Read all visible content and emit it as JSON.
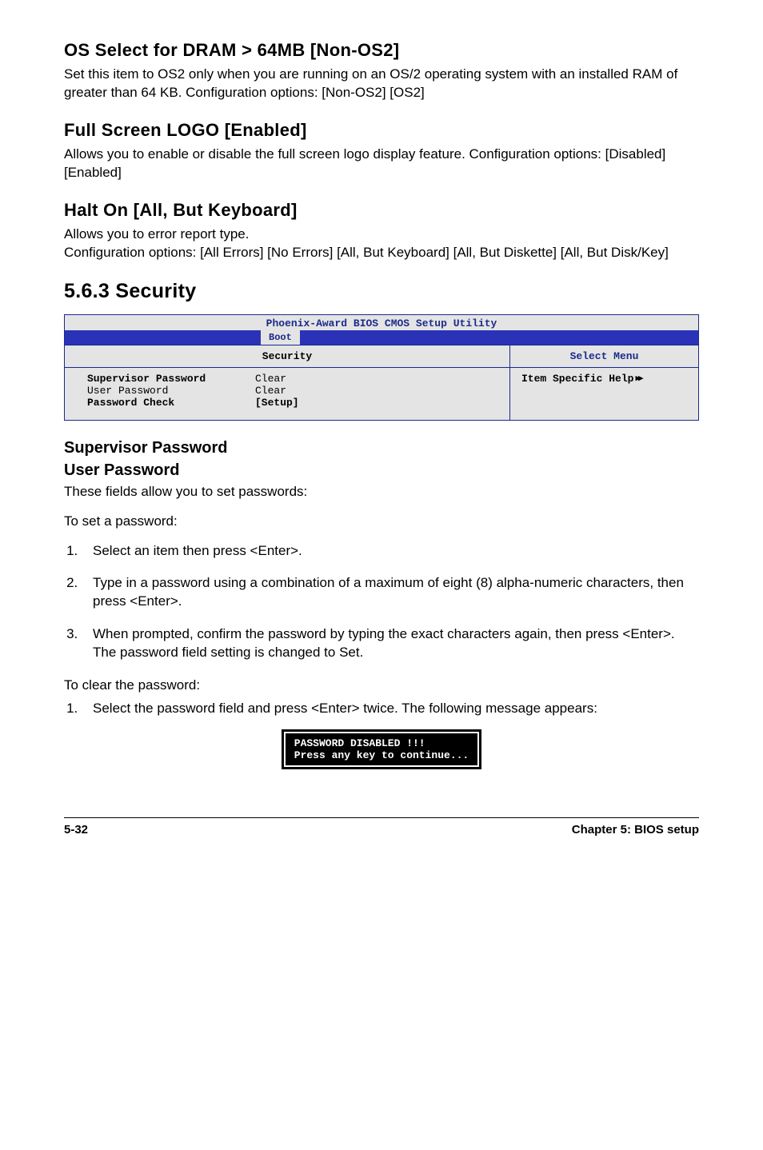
{
  "sec1": {
    "title": "OS Select for DRAM > 64MB [Non-OS2]",
    "body": "Set this item to OS2 only when you are running on an OS/2 operating system with an installed RAM of greater than 64 KB. Configuration options: [Non-OS2] [OS2]"
  },
  "sec2": {
    "title": "Full Screen LOGO [Enabled]",
    "body": "Allows you to enable or disable the full screen logo display feature. Configuration options: [Disabled] [Enabled]"
  },
  "sec3": {
    "title": "Halt On [All, But Keyboard]",
    "body1": "Allows you to error report type.",
    "body2": "Configuration options: [All Errors] [No Errors] [All, But Keyboard] [All, But Diskette] [All, But Disk/Key]"
  },
  "sec4": {
    "num_title": "5.6.3   Security"
  },
  "bios": {
    "util_title": "Phoenix-Award BIOS CMOS Setup Utility",
    "tab": "Boot",
    "left_title": "Security",
    "right_title": "Select Menu",
    "rows": [
      {
        "label": "Supervisor Password",
        "value": "Clear",
        "bold": true
      },
      {
        "label": "User Password",
        "value": "Clear",
        "bold": false
      },
      {
        "label": "Password Check",
        "value": "[Setup]",
        "bold": true
      }
    ],
    "help": "Item Specific Help"
  },
  "sec5": {
    "h1": "Supervisor Password",
    "h2": "User Password",
    "intro": "These fields allow you to set passwords:",
    "setpw": "To set a password:",
    "steps_set": [
      "Select an item then press <Enter>.",
      "Type in a password using a combination of a maximum of eight (8) alpha-numeric characters, then press <Enter>.",
      "When prompted, confirm the password by typing the exact characters again, then press <Enter>. The password field setting is changed to Set."
    ],
    "clearpw": "To clear the password:",
    "steps_clear": [
      "Select the password field and press <Enter> twice. The following message appears:"
    ]
  },
  "msgbox": "PASSWORD DISABLED !!!\nPress any key to continue...",
  "footer": {
    "page": "5-32",
    "chapter": "Chapter 5: BIOS setup"
  }
}
